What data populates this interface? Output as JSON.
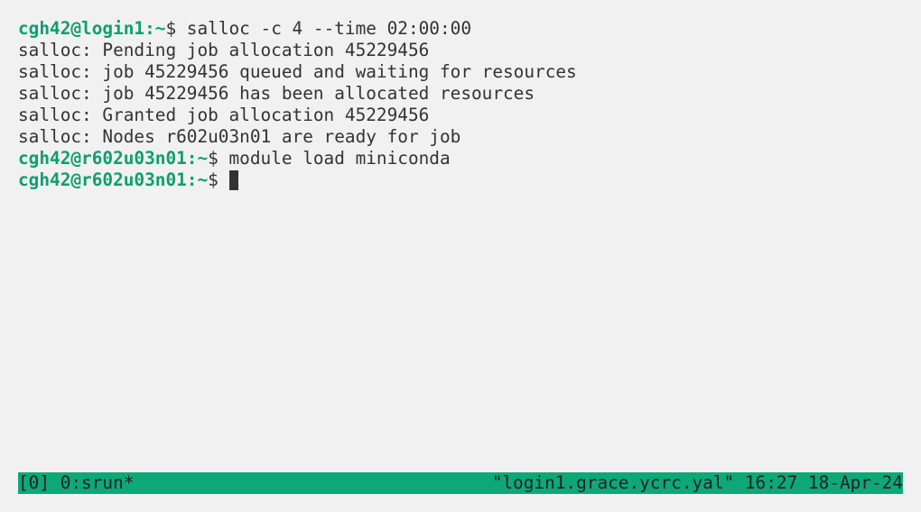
{
  "terminal": {
    "lines": [
      {
        "prompt": "cgh42@login1:~",
        "command": "$ salloc -c 4 --time 02:00:00"
      },
      {
        "output": "salloc: Pending job allocation 45229456"
      },
      {
        "output": "salloc: job 45229456 queued and waiting for resources"
      },
      {
        "output": "salloc: job 45229456 has been allocated resources"
      },
      {
        "output": "salloc: Granted job allocation 45229456"
      },
      {
        "output": "salloc: Nodes r602u03n01 are ready for job"
      },
      {
        "prompt": "cgh42@r602u03n01:~",
        "command": "$ module load miniconda"
      },
      {
        "prompt": "cgh42@r602u03n01:~",
        "command": "$ "
      }
    ]
  },
  "statusbar": {
    "left": "[0] 0:srun*",
    "right": "\"login1.grace.ycrc.yal\" 16:27 18-Apr-24"
  },
  "colors": {
    "background": "#f1f1f1",
    "prompt": "#0f9e6f",
    "statusbar": "#0ea878",
    "text": "#333333"
  }
}
